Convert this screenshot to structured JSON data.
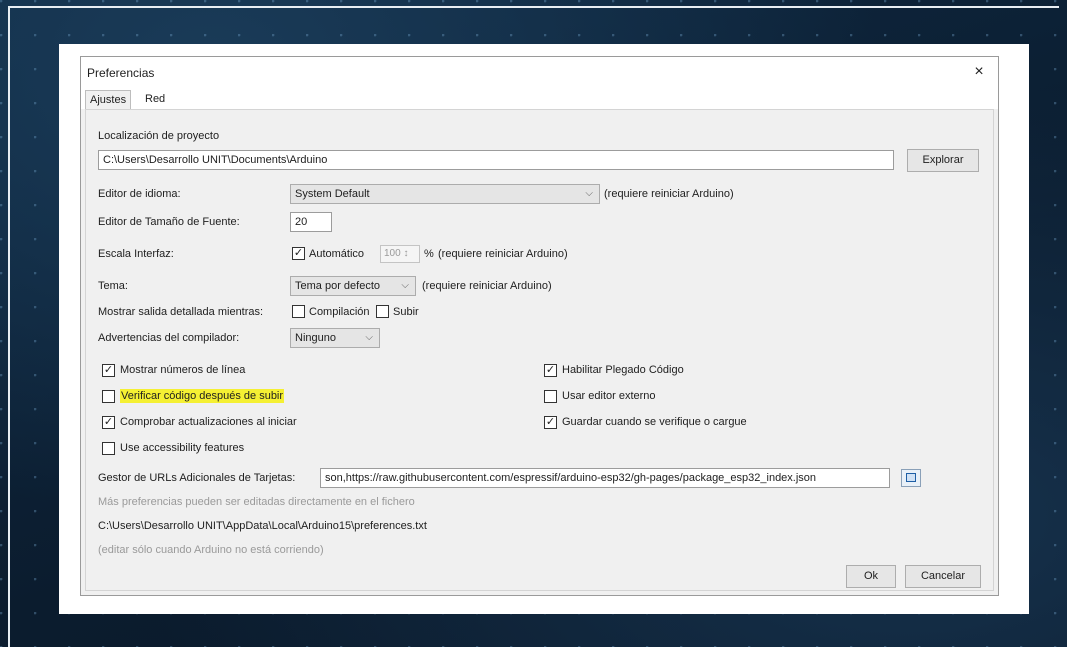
{
  "dialog": {
    "title": "Preferencias",
    "close_glyph": "×",
    "tabs": [
      {
        "label": "Ajustes"
      },
      {
        "label": "Red"
      }
    ]
  },
  "project": {
    "label": "Localización de proyecto",
    "path": "C:\\Users\\Desarrollo UNIT\\Documents\\Arduino",
    "browse_label": "Explorar"
  },
  "language": {
    "label": "Editor de idioma:",
    "value": "System Default",
    "note": "(requiere reiniciar Arduino)"
  },
  "font_size": {
    "label": "Editor de Tamaño de Fuente:",
    "value": "20"
  },
  "scale": {
    "label": "Escala Interfaz:",
    "auto_label": "Automático",
    "value": "100",
    "spin_glyph": "↕",
    "unit": "%",
    "note": "(requiere reiniciar Arduino)"
  },
  "theme": {
    "label": "Tema:",
    "value": "Tema por defecto",
    "note": "(requiere reiniciar Arduino)"
  },
  "verbose": {
    "label": "Mostrar salida detallada mientras:",
    "compile_label": "Compilación",
    "upload_label": "Subir"
  },
  "warnings": {
    "label": "Advertencias del compilador:",
    "value": "Ninguno"
  },
  "options_left": [
    {
      "label": "Mostrar números de línea",
      "checked": true
    },
    {
      "label": "Verificar código después de subir",
      "checked": false
    },
    {
      "label": "Comprobar actualizaciones al iniciar",
      "checked": true
    },
    {
      "label": "Use accessibility features",
      "checked": false
    }
  ],
  "options_right": [
    {
      "label": "Habilitar Plegado Código",
      "checked": true
    },
    {
      "label": "Usar editor externo",
      "checked": false
    },
    {
      "label": "Guardar cuando se verifique o cargue",
      "checked": true
    }
  ],
  "check_glyph": "✓",
  "arrow_glyph": "⌵",
  "boards": {
    "label": "Gestor de URLs Adicionales de Tarjetas:",
    "value": "son,https://raw.githubusercontent.com/espressif/arduino-esp32/gh-pages/package_esp32_index.json"
  },
  "footer": {
    "more_prefs": "Más preferencias pueden ser editadas directamente en el fichero",
    "prefs_path": "C:\\Users\\Desarrollo UNIT\\AppData\\Local\\Arduino15\\preferences.txt",
    "edit_note": "(editar sólo cuando Arduino no está corriendo)",
    "ok_label": "Ok",
    "cancel_label": "Cancelar"
  }
}
